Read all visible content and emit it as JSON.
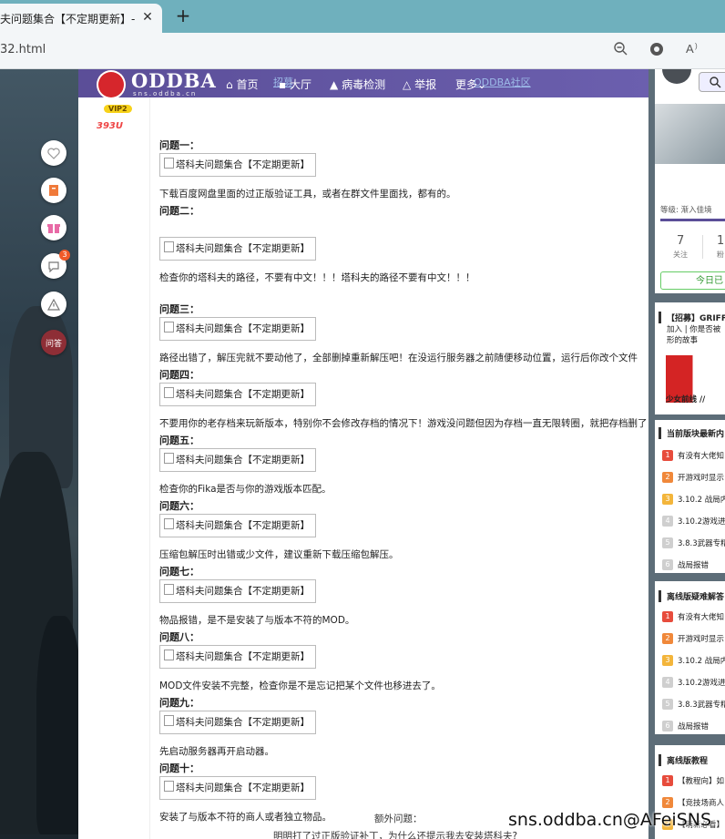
{
  "browser": {
    "tab_title": "夫问题集合【不定期更新】-C",
    "tab_close": "✕",
    "new_tab": "+",
    "url": "32.html"
  },
  "site": {
    "logo": "ODDBA",
    "logo_sub": "sns.oddba.cn",
    "nav": {
      "home": "首页",
      "hall": "大厅",
      "virus": "病毒检测",
      "report": "举报",
      "more": "更多",
      "ghost_1": "招募",
      "ghost_2": "ODDBA社区"
    },
    "float_badge": "3",
    "float_last": "问答"
  },
  "post": {
    "vip": "VIP2",
    "medal": "393U",
    "img_alt": "塔科夫问题集合【不定期更新】",
    "items": [
      {
        "q": "问题一：",
        "a": "下载百度网盘里面的过正版验证工具，或者在群文件里面找，都有的。"
      },
      {
        "q": "问题二：",
        "a": "检查你的塔科夫的路径，不要有中文！！！塔科夫的路径不要有中文！！！"
      },
      {
        "q": "问题三：",
        "a": "路径出错了，解压完就不要动他了，全部删掉重新解压吧！在没运行服务器之前随便移动位置，运行后你改个文件"
      },
      {
        "q": "问题四：",
        "a": "不要用你的老存档来玩新版本，特别你不会修改存档的情况下！游戏没问题但因为存档一直无限转圈，就把存档删了"
      },
      {
        "q": "问题五：",
        "a": "检查你的Fika是否与你的游戏版本匹配。"
      },
      {
        "q": "问题六：",
        "a": "压缩包解压时出错或少文件，建议重新下载压缩包解压。"
      },
      {
        "q": "问题七：",
        "a": "物品报错，是不是安装了与版本不符的MOD。"
      },
      {
        "q": "问题八：",
        "a": "MOD文件安装不完整，检查你是不是忘记把某个文件也移进去了。"
      },
      {
        "q": "问题九：",
        "a": "先启动服务器再开启动器。"
      },
      {
        "q": "问题十：",
        "a": "安装了与版本不符的商人或者独立物品。"
      }
    ],
    "extra_title": "额外问题：",
    "extra_line": "明明打了过正版验证补丁，为什么还提示我去安装塔科夫?"
  },
  "sidebar": {
    "level": "等级: 渐入佳境",
    "follow_count": "7",
    "follow_label": "关注",
    "fans_count": "1",
    "fans_label": "粉",
    "checkin": "今日已",
    "recruit": "【招募】GRIFF",
    "recruit_line2": "加入 | 你是否被",
    "recruit_line3": "形的故事",
    "banner_text": "少女前线 //",
    "sections": [
      {
        "title": "当前版块最新内",
        "items": [
          "有没有大佬知",
          "开游戏时显示",
          "3.10.2 战局内",
          "3.10.2游戏进",
          "3.8.3武器专精",
          "战局报错"
        ]
      },
      {
        "title": "离线版疑难解答",
        "items": [
          "有没有大佬知",
          "开游戏时显示",
          "3.10.2 战局内",
          "3.10.2游戏进",
          "3.8.3武器专精",
          "战局报错"
        ]
      },
      {
        "title": "离线版教程",
        "items": [
          "【教程向】如",
          "【竞技场商人",
          "【萌新必看】"
        ]
      }
    ]
  },
  "watermark": "sns.oddba.cn@AFeiSNS",
  "colors": {
    "nav": "#5b4e98",
    "accent": "#e4b04a",
    "rank": [
      "#e74c3c",
      "#f0883a",
      "#f3b53b",
      "#cfcfcf"
    ]
  }
}
